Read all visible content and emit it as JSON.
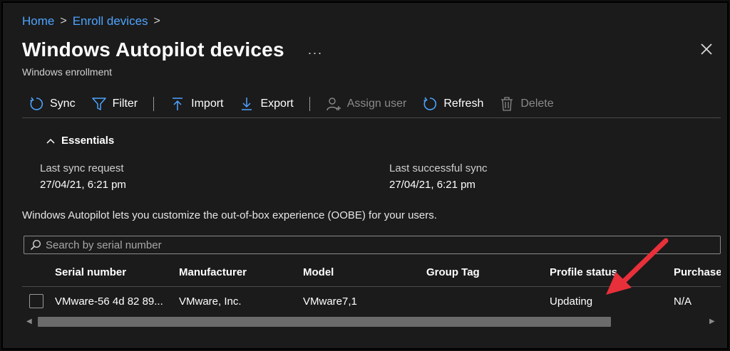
{
  "breadcrumb": {
    "home": "Home",
    "enroll": "Enroll devices",
    "sep": ">"
  },
  "header": {
    "title": "Windows Autopilot devices",
    "more": "...",
    "subtitle": "Windows enrollment"
  },
  "toolbar": {
    "sync": "Sync",
    "filter": "Filter",
    "import": "Import",
    "export": "Export",
    "assign_user": "Assign user",
    "refresh": "Refresh",
    "delete": "Delete"
  },
  "essentials": {
    "label": "Essentials",
    "last_sync_request_label": "Last sync request",
    "last_sync_request_value": "27/04/21, 6:21 pm",
    "last_successful_sync_label": "Last successful sync",
    "last_successful_sync_value": "27/04/21, 6:21 pm"
  },
  "description": "Windows Autopilot lets you customize the out-of-box experience (OOBE) for your users.",
  "search": {
    "placeholder": "Search by serial number"
  },
  "table": {
    "columns": [
      "Serial number",
      "Manufacturer",
      "Model",
      "Group Tag",
      "Profile status",
      "Purchase"
    ],
    "rows": [
      {
        "serial": "VMware-56 4d 82 89...",
        "manufacturer": "VMware, Inc.",
        "model": "VMware7,1",
        "group_tag": "",
        "profile_status": "Updating",
        "purchase": "N/A"
      }
    ]
  },
  "colors": {
    "accent": "#4da3ff",
    "annotation_arrow": "#e8303a",
    "background": "#1b1b1b"
  }
}
